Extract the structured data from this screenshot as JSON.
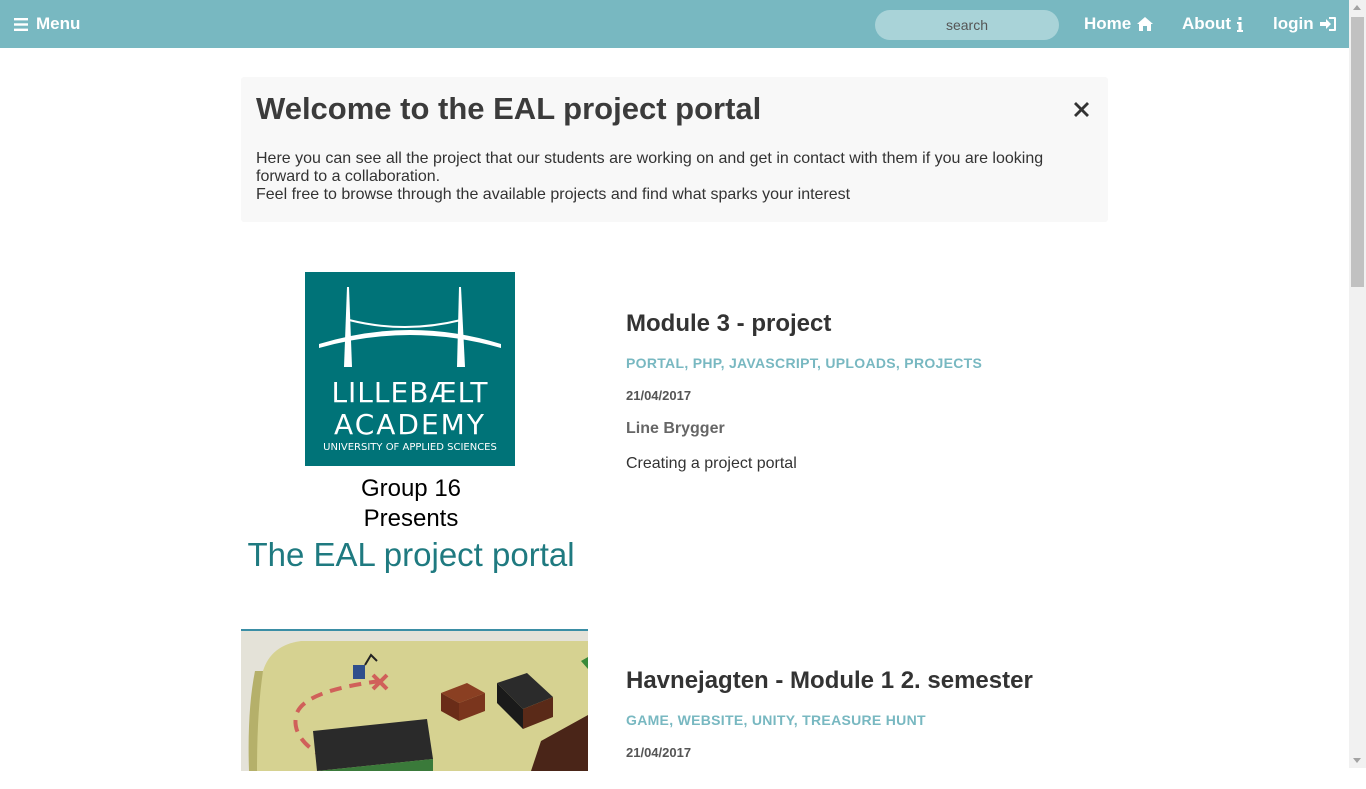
{
  "nav": {
    "menu_label": "Menu",
    "search_placeholder": "search",
    "home_label": "Home",
    "about_label": "About",
    "login_label": "login",
    "bg_color": "#78b8c1"
  },
  "welcome": {
    "title": "Welcome to the EAL project portal",
    "line1": "Here you can see all the project that our students are working on and get in contact with them if you are looking forward to a collaboration.",
    "line2": "Feel free to browse through the available projects and find what sparks your interest"
  },
  "projects": [
    {
      "title": "Module 3 - project",
      "tags": "PORTAL, PHP, JAVASCRIPT, UPLOADS, PROJECTS",
      "date": "21/04/2017",
      "author": "Line Brygger",
      "description": "Creating a project portal",
      "thumb": {
        "logo_line1": "LILLEBÆLT",
        "logo_line2": "ACADEMY",
        "logo_line3": "UNIVERSITY OF APPLIED SCIENCES",
        "line1": "Group 16",
        "line2": "Presents",
        "line3": "The EAL project portal"
      }
    },
    {
      "title": "Havnejagten - Module 1 2. semester",
      "tags": "GAME, WEBSITE, UNITY, TREASURE HUNT",
      "date": "21/04/2017"
    }
  ],
  "colors": {
    "accent": "#78b8c1",
    "logo_bg": "#007378"
  }
}
